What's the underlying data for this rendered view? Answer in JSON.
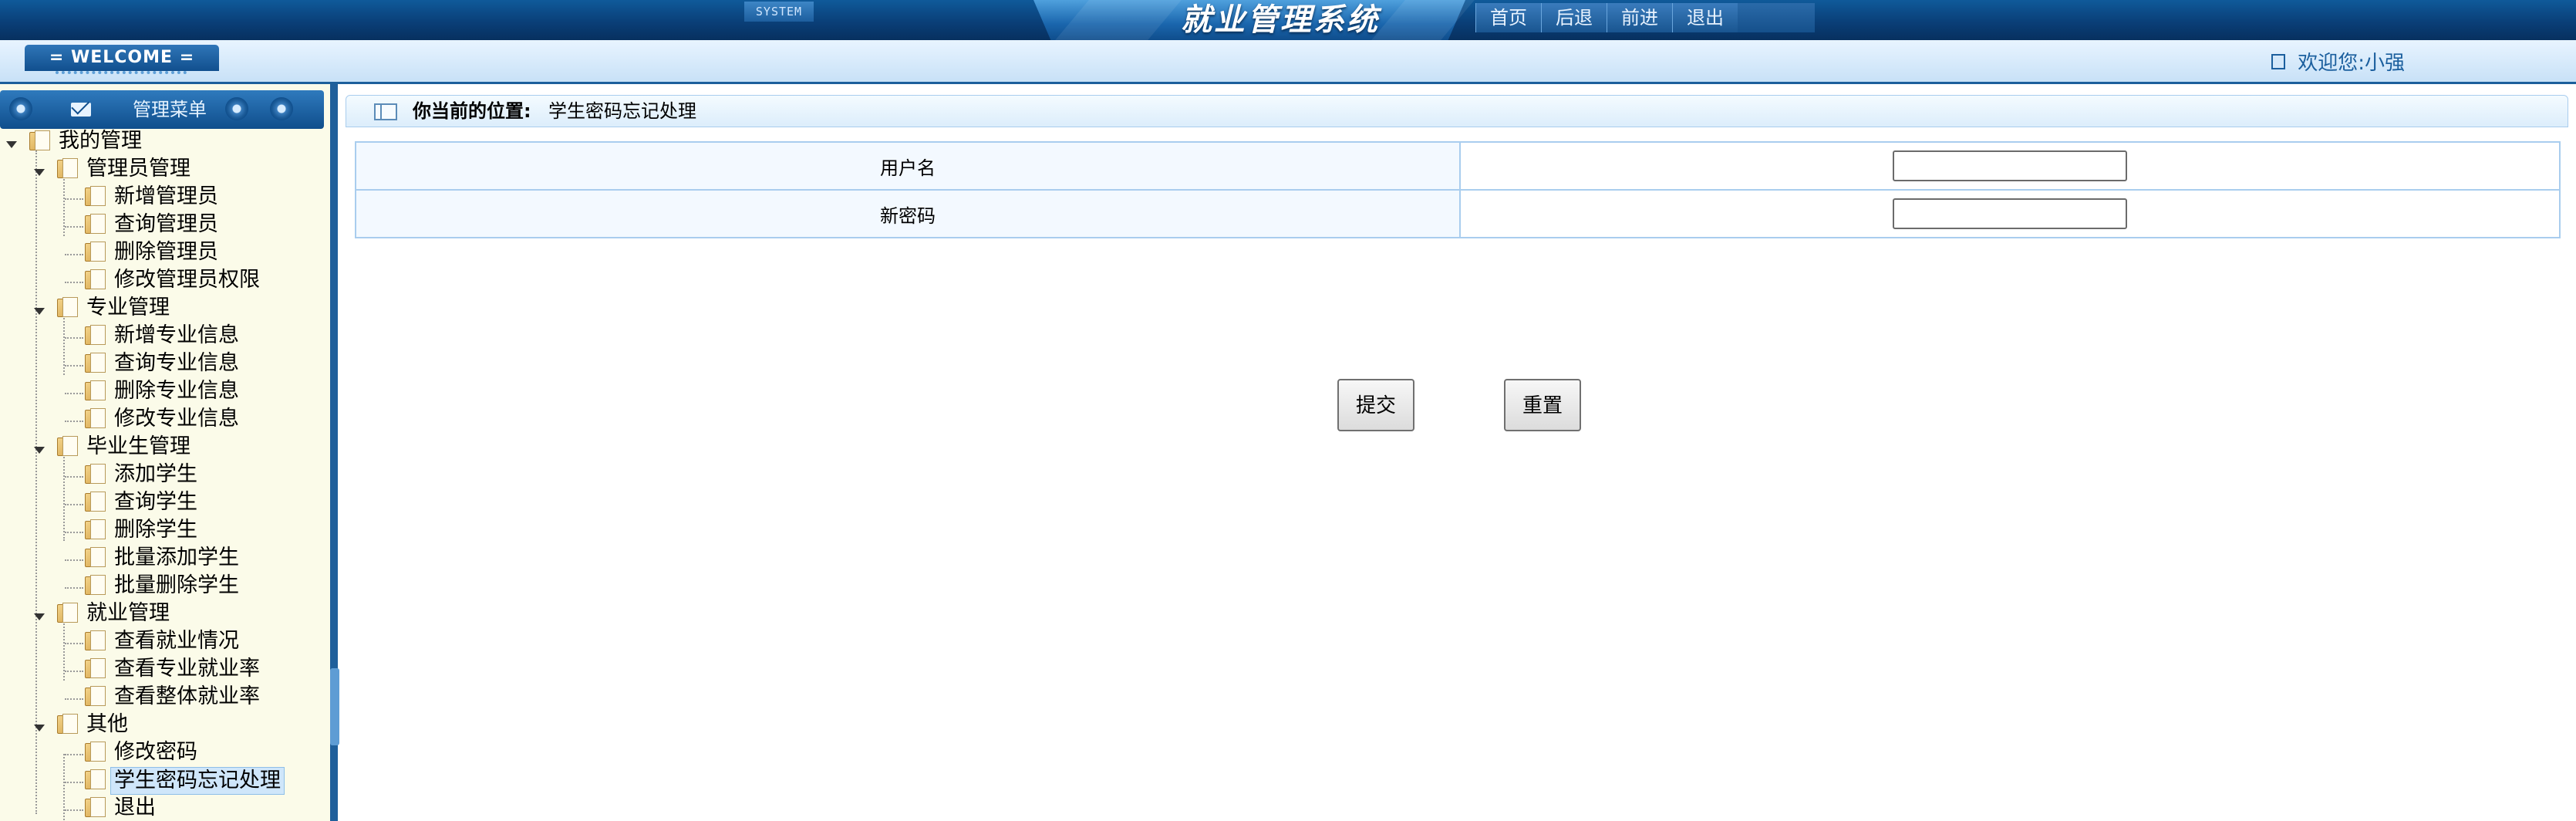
{
  "header": {
    "system_tag": "SYSTEM",
    "app_title": "就业管理系统",
    "nav": {
      "home": "首页",
      "back": "后退",
      "forward": "前进",
      "exit": "退出"
    }
  },
  "subbar": {
    "welcome_tab": "= WELCOME =",
    "greeting": "欢迎您:小强"
  },
  "sidebar": {
    "menu_title": "管理菜单",
    "root": "我的管理",
    "groups": [
      {
        "label": "管理员管理",
        "items": [
          "新增管理员",
          "查询管理员",
          "删除管理员",
          "修改管理员权限"
        ]
      },
      {
        "label": "专业管理",
        "items": [
          "新增专业信息",
          "查询专业信息",
          "删除专业信息",
          "修改专业信息"
        ]
      },
      {
        "label": "毕业生管理",
        "items": [
          "添加学生",
          "查询学生",
          "删除学生",
          "批量添加学生",
          "批量删除学生"
        ]
      },
      {
        "label": "就业管理",
        "items": [
          "查看就业情况",
          "查看专业就业率",
          "查看整体就业率"
        ]
      },
      {
        "label": "其他",
        "items": [
          "修改密码",
          "学生密码忘记处理",
          "退出"
        ]
      }
    ],
    "selected_item": "学生密码忘记处理"
  },
  "main": {
    "breadcrumb_label": "你当前的位置:",
    "breadcrumb_value": "学生密码忘记处理",
    "form": {
      "username_label": "用户名",
      "username_value": "",
      "new_password_label": "新密码",
      "new_password_value": ""
    },
    "buttons": {
      "submit": "提交",
      "reset": "重置"
    }
  }
}
